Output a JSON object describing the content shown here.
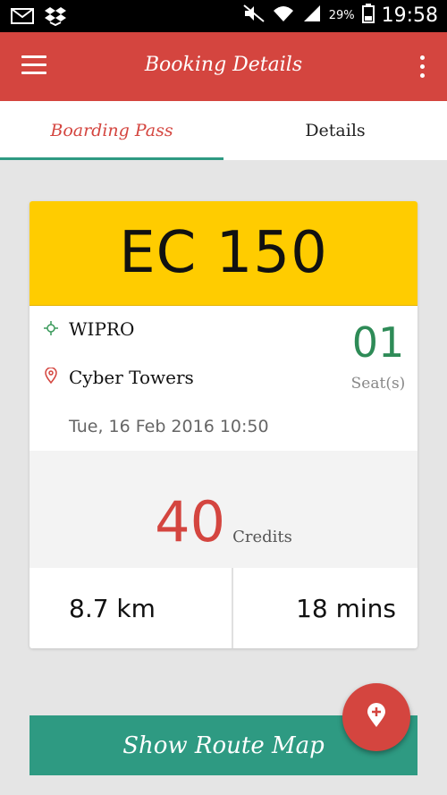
{
  "status_bar": {
    "battery_percent": "29%",
    "time": "19:58",
    "icons": [
      "mail-icon",
      "dropbox-icon",
      "mute-icon",
      "wifi-icon",
      "signal-icon",
      "battery-icon"
    ]
  },
  "app_bar": {
    "title": "Booking Details",
    "menu_icon": "hamburger-menu-icon",
    "more_icon": "more-vertical-icon",
    "background_color": "#d4453f"
  },
  "tabs": [
    {
      "label": "Boarding Pass",
      "active": true
    },
    {
      "label": "Details",
      "active": false
    }
  ],
  "boarding_pass": {
    "vehicle_code": "EC 150",
    "from": "WIPRO",
    "to": "Cyber Towers",
    "datetime": "Tue, 16 Feb 2016 10:50",
    "seats_value": "01",
    "seats_label": "Seat(s)",
    "credits_value": "40",
    "credits_label": "Credits",
    "distance": "8.7 km",
    "duration": "18 mins",
    "header_color": "#ffcc00"
  },
  "actions": {
    "show_route_label": "Show Route Map",
    "fab_icon": "location-add-icon",
    "accent_color": "#2e9a82"
  }
}
